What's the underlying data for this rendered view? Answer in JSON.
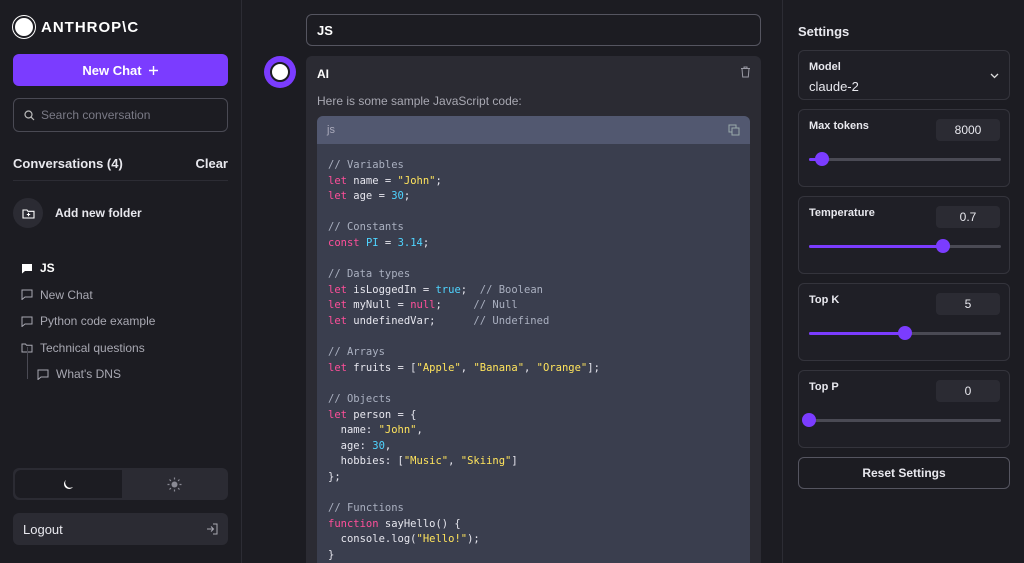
{
  "brand": {
    "name": "ANTHROP\\C"
  },
  "sidebar": {
    "new_chat_label": "New Chat",
    "search_placeholder": "Search conversation",
    "conversations_header": "Conversations (4)",
    "clear_label": "Clear",
    "add_folder_label": "Add new folder",
    "items": [
      {
        "label": "JS",
        "icon": "chat-filled-icon",
        "active": true
      },
      {
        "label": "New Chat",
        "icon": "chat-outline-icon"
      },
      {
        "label": "Python code example",
        "icon": "chat-outline-icon"
      },
      {
        "label": "Technical questions",
        "icon": "folder-icon"
      },
      {
        "label": "What's DNS",
        "icon": "chat-outline-icon",
        "nested": true
      }
    ],
    "theme": {
      "selected": "dark"
    },
    "logout_label": "Logout"
  },
  "main": {
    "conversation_title": "JS",
    "message": {
      "author": "AI",
      "intro": "Here is some sample JavaScript code:",
      "code_lang": "js",
      "code_lines": [
        [
          [
            "cm",
            "// Variables"
          ]
        ],
        [
          [
            "kw",
            "let"
          ],
          [
            "pl",
            " name = "
          ],
          [
            "str",
            "\"John\""
          ],
          [
            "pl",
            ";"
          ]
        ],
        [
          [
            "kw",
            "let"
          ],
          [
            "pl",
            " age = "
          ],
          [
            "num",
            "30"
          ],
          [
            "pl",
            ";"
          ]
        ],
        [],
        [
          [
            "cm",
            "// Constants"
          ]
        ],
        [
          [
            "kw",
            "const"
          ],
          [
            "pl",
            " "
          ],
          [
            "num",
            "PI"
          ],
          [
            "pl",
            " = "
          ],
          [
            "num",
            "3.14"
          ],
          [
            "pl",
            ";"
          ]
        ],
        [],
        [
          [
            "cm",
            "// Data types"
          ]
        ],
        [
          [
            "kw",
            "let"
          ],
          [
            "pl",
            " isLoggedIn = "
          ],
          [
            "num",
            "true"
          ],
          [
            "pl",
            ";  "
          ],
          [
            "cm",
            "// Boolean"
          ]
        ],
        [
          [
            "kw",
            "let"
          ],
          [
            "pl",
            " myNull = "
          ],
          [
            "kw",
            "null"
          ],
          [
            "pl",
            ";     "
          ],
          [
            "cm",
            "// Null"
          ]
        ],
        [
          [
            "kw",
            "let"
          ],
          [
            "pl",
            " undefinedVar;      "
          ],
          [
            "cm",
            "// Undefined"
          ]
        ],
        [],
        [
          [
            "cm",
            "// Arrays"
          ]
        ],
        [
          [
            "kw",
            "let"
          ],
          [
            "pl",
            " fruits = ["
          ],
          [
            "str",
            "\"Apple\""
          ],
          [
            "pl",
            ", "
          ],
          [
            "str",
            "\"Banana\""
          ],
          [
            "pl",
            ", "
          ],
          [
            "str",
            "\"Orange\""
          ],
          [
            "pl",
            "];"
          ]
        ],
        [],
        [
          [
            "cm",
            "// Objects"
          ]
        ],
        [
          [
            "kw",
            "let"
          ],
          [
            "pl",
            " person = {"
          ]
        ],
        [
          [
            "pl",
            "  name: "
          ],
          [
            "str",
            "\"John\""
          ],
          [
            "pl",
            ","
          ]
        ],
        [
          [
            "pl",
            "  age: "
          ],
          [
            "num",
            "30"
          ],
          [
            "pl",
            ","
          ]
        ],
        [
          [
            "pl",
            "  hobbies: ["
          ],
          [
            "str",
            "\"Music\""
          ],
          [
            "pl",
            ", "
          ],
          [
            "str",
            "\"Skiing\""
          ],
          [
            "pl",
            "]"
          ]
        ],
        [
          [
            "pl",
            "};"
          ]
        ],
        [],
        [
          [
            "cm",
            "// Functions"
          ]
        ],
        [
          [
            "kw",
            "function"
          ],
          [
            "pl",
            " sayHello() {"
          ]
        ],
        [
          [
            "pl",
            "  console.log("
          ],
          [
            "str",
            "\"Hello!\""
          ],
          [
            "pl",
            ");"
          ]
        ],
        [
          [
            "pl",
            "}"
          ]
        ]
      ]
    }
  },
  "settings": {
    "title": "Settings",
    "model": {
      "label": "Model",
      "value": "claude-2"
    },
    "max_tokens": {
      "label": "Max tokens",
      "value": "8000",
      "fraction": 0.07
    },
    "temperature": {
      "label": "Temperature",
      "value": "0.7",
      "fraction": 0.7
    },
    "top_k": {
      "label": "Top K",
      "value": "5",
      "fraction": 0.5
    },
    "top_p": {
      "label": "Top P",
      "value": "0",
      "fraction": 0.0
    },
    "reset_label": "Reset Settings"
  },
  "colors": {
    "accent": "#7b3cff",
    "keyword": "#ff4f9a",
    "string": "#ffe45c",
    "number": "#4fd4ff"
  }
}
